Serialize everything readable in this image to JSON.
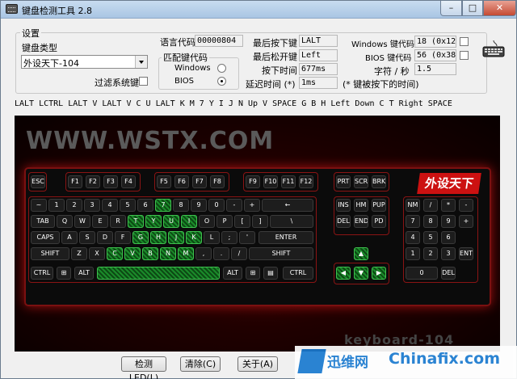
{
  "window": {
    "title": "键盘检测工具 2.8"
  },
  "settings": {
    "group_label": "设置",
    "keyboard_type_label": "键盘类型",
    "keyboard_type_value": "外设天下-104",
    "filter_label": "过滤系统键",
    "lang_code_label": "语言代码",
    "lang_code_value": "00000804",
    "match_label": "匹配键代码",
    "match_options": [
      "Windows",
      "BIOS"
    ],
    "match_selected": "BIOS",
    "last_pressed_label": "最后按下键",
    "last_pressed_value": "LALT",
    "last_released_label": "最后松开键",
    "last_released_value": "Left",
    "press_time_label": "按下时间",
    "press_time_value": "677ms",
    "delay_label": "延迟时间 (*)",
    "delay_value": "1ms",
    "delay_note": "(* 键被按下的时间)",
    "win_code_label": "Windows 键代码",
    "win_code_value": "18 (0x12)",
    "bios_code_label": "BIOS 键代码",
    "bios_code_value": "56 (0x38)",
    "chars_label": "字符 / 秒",
    "chars_value": "1.5"
  },
  "log": {
    "text": "LALT LCTRL LALT V LALT V C U LALT K M 7 Y I J N Up V SPACE G B H Left Down C T Right SPACE"
  },
  "stage": {
    "watermark": "WWW.WSTX.COM",
    "brand": "外设天下",
    "model": "keyboard-104"
  },
  "keys": [
    {
      "l": "ESC"
    },
    {
      "l": "F1"
    },
    {
      "l": "F2"
    },
    {
      "l": "F3"
    },
    {
      "l": "F4"
    },
    {
      "l": "F5"
    },
    {
      "l": "F6"
    },
    {
      "l": "F7"
    },
    {
      "l": "F8"
    },
    {
      "l": "F9"
    },
    {
      "l": "F10"
    },
    {
      "l": "F11"
    },
    {
      "l": "F12"
    },
    {
      "l": "PRT"
    },
    {
      "l": "SCRL"
    },
    {
      "l": "BRK"
    },
    {
      "l": "~"
    },
    {
      "l": "1"
    },
    {
      "l": "2"
    },
    {
      "l": "3"
    },
    {
      "l": "4"
    },
    {
      "l": "5"
    },
    {
      "l": "6"
    },
    {
      "l": "7",
      "on": 1
    },
    {
      "l": "8"
    },
    {
      "l": "9"
    },
    {
      "l": "0"
    },
    {
      "l": "-"
    },
    {
      "l": "+"
    },
    {
      "l": "←"
    },
    {
      "l": "INS"
    },
    {
      "l": "HM"
    },
    {
      "l": "PUP"
    },
    {
      "l": "NM"
    },
    {
      "l": "/"
    },
    {
      "l": "*"
    },
    {
      "l": "-"
    },
    {
      "l": "TAB"
    },
    {
      "l": "Q"
    },
    {
      "l": "W"
    },
    {
      "l": "E"
    },
    {
      "l": "R"
    },
    {
      "l": "T",
      "on": 1
    },
    {
      "l": "Y",
      "on": 1
    },
    {
      "l": "U",
      "on": 1
    },
    {
      "l": "I",
      "on": 1
    },
    {
      "l": "O"
    },
    {
      "l": "P"
    },
    {
      "l": "["
    },
    {
      "l": "]"
    },
    {
      "l": "\\"
    },
    {
      "l": "DEL"
    },
    {
      "l": "END"
    },
    {
      "l": "PD"
    },
    {
      "l": "7"
    },
    {
      "l": "8"
    },
    {
      "l": "9"
    },
    {
      "l": "+"
    },
    {
      "l": "CAPS"
    },
    {
      "l": "A"
    },
    {
      "l": "S"
    },
    {
      "l": "D"
    },
    {
      "l": "F"
    },
    {
      "l": "G",
      "on": 1
    },
    {
      "l": "H",
      "on": 1
    },
    {
      "l": "J",
      "on": 1
    },
    {
      "l": "K",
      "on": 1
    },
    {
      "l": "L"
    },
    {
      "l": ";"
    },
    {
      "l": "'"
    },
    {
      "l": "ENTER"
    },
    {
      "l": "4"
    },
    {
      "l": "5"
    },
    {
      "l": "6"
    },
    {
      "l": "SHIFT"
    },
    {
      "l": "Z"
    },
    {
      "l": "X"
    },
    {
      "l": "C",
      "on": 1
    },
    {
      "l": "V",
      "on": 1
    },
    {
      "l": "B",
      "on": 1
    },
    {
      "l": "N",
      "on": 1
    },
    {
      "l": "M",
      "on": 1
    },
    {
      "l": ","
    },
    {
      "l": "."
    },
    {
      "l": "/"
    },
    {
      "l": "SHIFT"
    },
    {
      "l": "▲",
      "on": 1
    },
    {
      "l": "1"
    },
    {
      "l": "2"
    },
    {
      "l": "3"
    },
    {
      "l": "ENT"
    },
    {
      "l": "CTRL"
    },
    {
      "l": "⊞"
    },
    {
      "l": "ALT"
    },
    {
      "l": "",
      "on": 1
    },
    {
      "l": "ALT"
    },
    {
      "l": "⊞"
    },
    {
      "l": "▤"
    },
    {
      "l": "CTRL"
    },
    {
      "l": "◀",
      "on": 1
    },
    {
      "l": "▼",
      "on": 1
    },
    {
      "l": "▶",
      "on": 1
    },
    {
      "l": "0"
    },
    {
      "l": "DEL"
    }
  ],
  "buttons": {
    "detect": "检测LED(L)",
    "clear": "清除(C)",
    "about": "关于(A)"
  },
  "badge": {
    "left": "迅维网",
    "right": "Chinafix.com"
  }
}
